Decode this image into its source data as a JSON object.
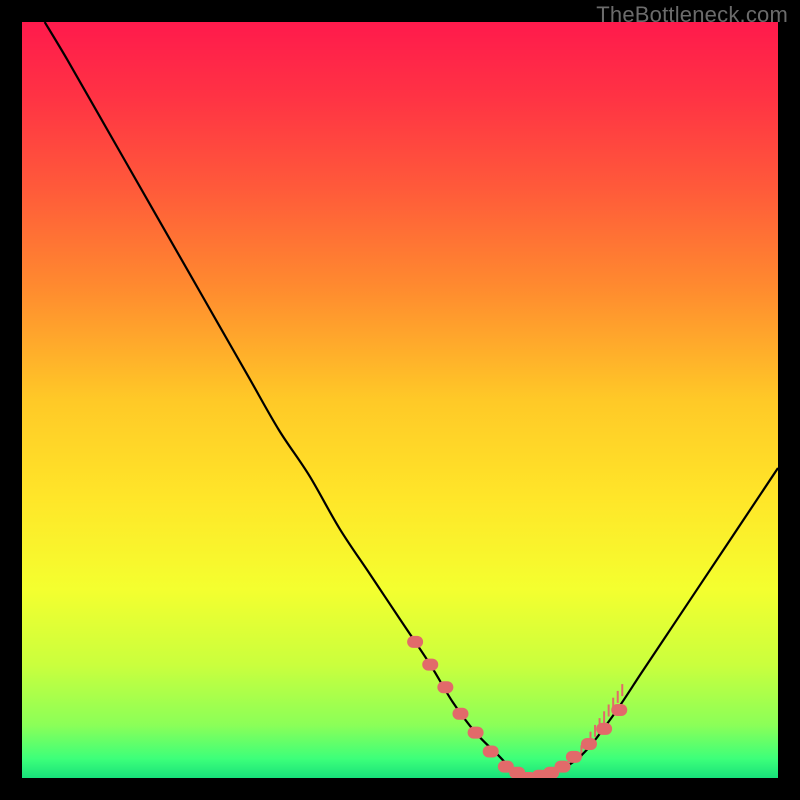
{
  "watermark": "TheBottleneck.com",
  "chart_data": {
    "type": "line",
    "title": "",
    "xlabel": "",
    "ylabel": "",
    "xlim": [
      0,
      100
    ],
    "ylim": [
      0,
      100
    ],
    "series": [
      {
        "name": "bottleneck-curve",
        "x": [
          3,
          6,
          10,
          14,
          18,
          22,
          26,
          30,
          34,
          38,
          42,
          46,
          50,
          54,
          57,
          60,
          63,
          65,
          67,
          70,
          74,
          78,
          82,
          86,
          90,
          94,
          98,
          100
        ],
        "y": [
          100,
          95,
          88,
          81,
          74,
          67,
          60,
          53,
          46,
          40,
          33,
          27,
          21,
          15,
          10,
          6,
          3,
          1,
          0,
          0.5,
          3,
          8,
          14,
          20,
          26,
          32,
          38,
          41
        ]
      }
    ],
    "markers": {
      "name": "highlight-dots",
      "x": [
        52,
        54,
        56,
        58,
        60,
        62,
        64,
        65.5,
        67,
        68.5,
        70,
        71.5,
        73,
        75,
        77,
        79
      ],
      "y": [
        18,
        15,
        12,
        8.5,
        6,
        3.5,
        1.5,
        0.7,
        0,
        0.3,
        0.7,
        1.5,
        2.8,
        4.5,
        6.5,
        9
      ]
    },
    "gradient_stops": [
      {
        "offset": 0.0,
        "color": "#ff1a4c"
      },
      {
        "offset": 0.1,
        "color": "#ff3344"
      },
      {
        "offset": 0.22,
        "color": "#ff5a3a"
      },
      {
        "offset": 0.35,
        "color": "#ff8a2f"
      },
      {
        "offset": 0.5,
        "color": "#ffc927"
      },
      {
        "offset": 0.63,
        "color": "#ffe629"
      },
      {
        "offset": 0.75,
        "color": "#f4ff2f"
      },
      {
        "offset": 0.85,
        "color": "#caff3d"
      },
      {
        "offset": 0.93,
        "color": "#8bff58"
      },
      {
        "offset": 0.975,
        "color": "#3cff7a"
      },
      {
        "offset": 1.0,
        "color": "#17e07a"
      }
    ],
    "curve_color": "#000000",
    "marker_color": "#e26a6a",
    "tick_color": "#e26a6a"
  }
}
